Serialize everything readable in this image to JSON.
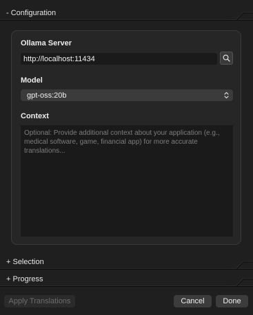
{
  "sections": {
    "configuration": {
      "label": "- Configuration",
      "expanded": true
    },
    "selection": {
      "label": "+ Selection",
      "expanded": false
    },
    "progress": {
      "label": "+ Progress",
      "expanded": false
    }
  },
  "config": {
    "server_label": "Ollama Server",
    "server_value": "http://localhost:11434",
    "search_icon": "magnifying-glass",
    "model_label": "Model",
    "model_value": "gpt-oss:20b",
    "model_chevron_icon": "up-down-chevron",
    "context_label": "Context",
    "context_value": "",
    "context_placeholder": "Optional: Provide additional context about your application (e.g., medical software, game, financial app) for more accurate translations..."
  },
  "footer": {
    "apply_label": "Apply Translations",
    "apply_enabled": false,
    "cancel_label": "Cancel",
    "done_label": "Done"
  }
}
